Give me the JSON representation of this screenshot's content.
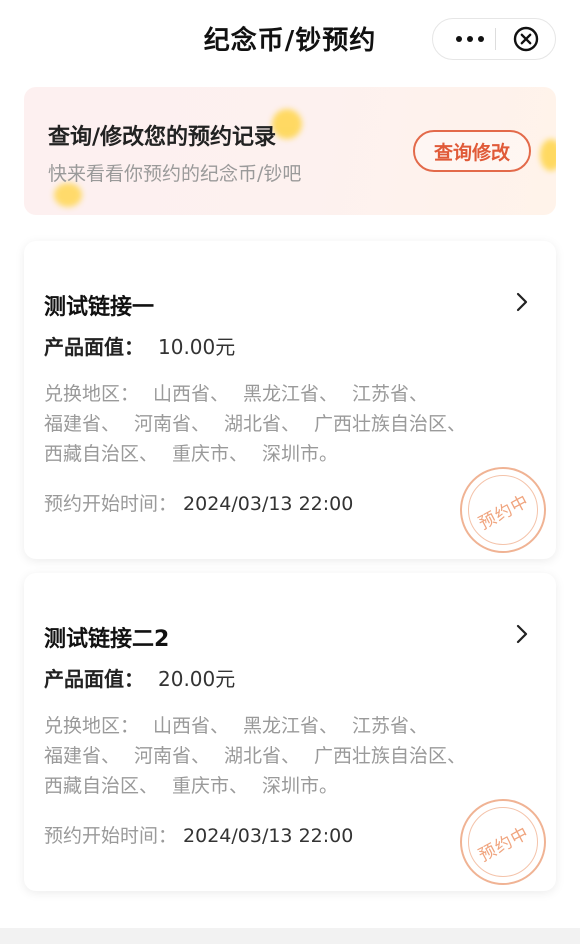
{
  "header": {
    "title": "纪念币/钞预约",
    "more_icon": "more-dots-icon",
    "close_icon": "close-circle-icon"
  },
  "banner": {
    "title": "查询/修改您的预约记录",
    "subtitle": "快来看看你预约的纪念币/钞吧",
    "button_label": "查询修改",
    "accent_color": "#e05a38"
  },
  "cards": [
    {
      "title": "测试链接一",
      "face_value_label": "产品面值：",
      "face_value": "10.00元",
      "region_label": "兑换地区：",
      "regions": [
        "山西省、",
        "黑龙江省、",
        "江苏省、",
        "福建省、",
        "河南省、",
        "湖北省、",
        "广西壮族自治区、",
        "西藏自治区、",
        "重庆市、",
        "深圳市。"
      ],
      "time_label": "预约开始时间：",
      "time_value": "2024/03/13 22:00",
      "status": "预约中"
    },
    {
      "title": "测试链接二2",
      "face_value_label": "产品面值：",
      "face_value": "20.00元",
      "region_label": "兑换地区：",
      "regions": [
        "山西省、",
        "黑龙江省、",
        "江苏省、",
        "福建省、",
        "河南省、",
        "湖北省、",
        "广西壮族自治区、",
        "西藏自治区、",
        "重庆市、",
        "深圳市。"
      ],
      "time_label": "预约开始时间：",
      "time_value": "2024/03/13 22:00",
      "status": "预约中"
    }
  ]
}
